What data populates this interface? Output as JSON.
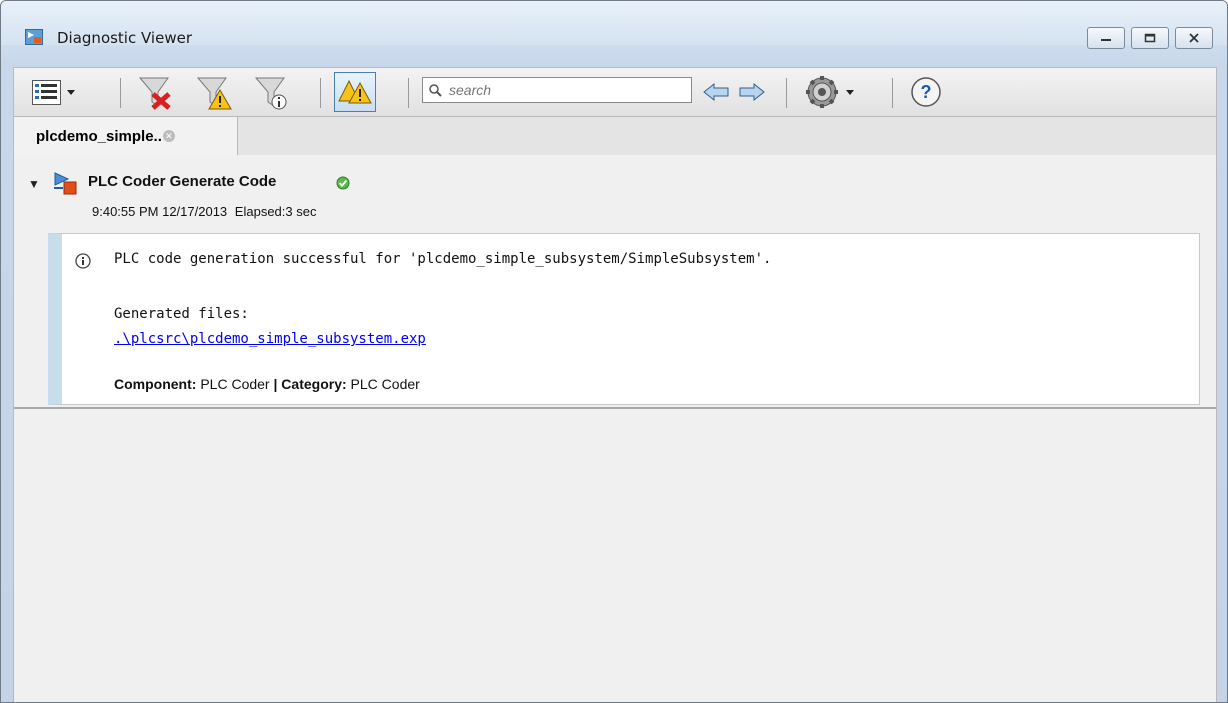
{
  "window": {
    "title": "Diagnostic Viewer"
  },
  "toolbar": {
    "search_placeholder": "search",
    "buttons": [
      {
        "name": "view-options",
        "icon": "list-view-icon"
      },
      {
        "name": "filter-errors",
        "icon": "filter-error-icon"
      },
      {
        "name": "filter-warnings",
        "icon": "filter-warning-icon"
      },
      {
        "name": "filter-info",
        "icon": "filter-info-icon"
      },
      {
        "name": "group-warnings",
        "icon": "warnings-toggle-icon",
        "active": true
      },
      {
        "name": "previous",
        "icon": "arrow-left-icon"
      },
      {
        "name": "next",
        "icon": "arrow-right-icon"
      },
      {
        "name": "settings",
        "icon": "gear-icon"
      },
      {
        "name": "help",
        "icon": "help-icon"
      }
    ]
  },
  "tab": {
    "label": "plcdemo_simple.."
  },
  "run": {
    "title": "PLC Coder Generate Code",
    "timestamp": "9:40:55 PM 12/17/2013",
    "elapsed": "Elapsed:3 sec",
    "status": "success"
  },
  "message": {
    "text": "PLC code generation successful for 'plcdemo_simple_subsystem/SimpleSubsystem'.",
    "generated_label": "Generated files:",
    "file_link": ".\\plcsrc\\plcdemo_simple_subsystem.exp",
    "component_label": "Component:",
    "component_value": "PLC Coder",
    "separator": "|",
    "category_label": "Category:",
    "category_value": "PLC Coder"
  },
  "colors": {
    "accent_bar": "#c6ddec",
    "link": "#0000ee",
    "success": "#3a9b2a"
  }
}
